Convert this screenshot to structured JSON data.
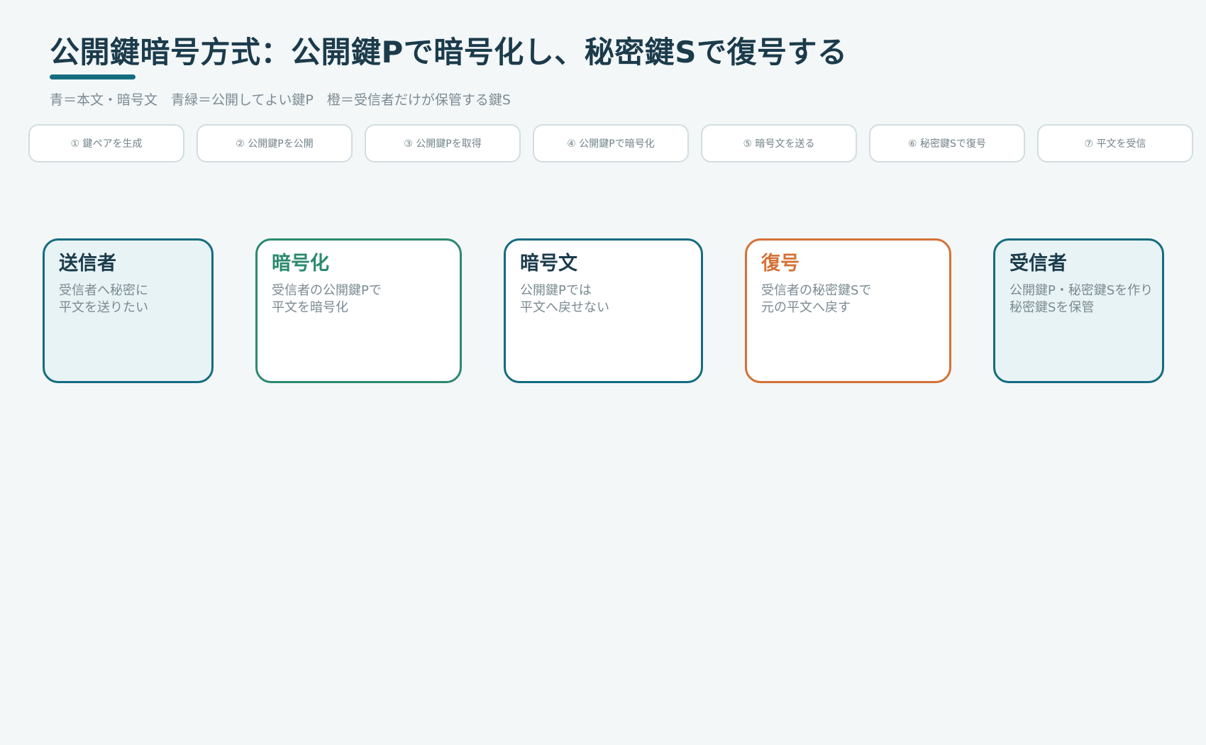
{
  "title": "公開鍵暗号方式：公開鍵Pで暗号化し、秘密鍵Sで復号する",
  "legend": "青＝本文・暗号文　青緑＝公開してよい鍵P　橙＝受信者だけが保管する鍵S",
  "steps": [
    "① 鍵ペアを生成",
    "② 公開鍵Pを公開",
    "③ 公開鍵Pを取得",
    "④ 公開鍵Pで暗号化",
    "⑤ 暗号文を送る",
    "⑥ 秘密鍵Sで復号",
    "⑦ 平文を受信"
  ],
  "nodes": [
    {
      "title": "送信者",
      "line1": "受信者へ秘密に",
      "line2": "平文を送りたい"
    },
    {
      "title": "暗号化",
      "line1": "受信者の公開鍵Pで",
      "line2": "平文を暗号化"
    },
    {
      "title": "暗号文",
      "line1": "公開鍵Pでは",
      "line2": "平文へ戻せない"
    },
    {
      "title": "復号",
      "line1": "受信者の秘密鍵Sで",
      "line2": "元の平文へ戻す"
    },
    {
      "title": "受信者",
      "line1": "公開鍵P・秘密鍵Sを作り",
      "line2": "秘密鍵Sを保管"
    }
  ],
  "colors": {
    "text_blue": "#146c80",
    "public_key_teal": "#2b8a6e",
    "secret_key_orange": "#d57136",
    "background": "#f3f7f8"
  }
}
